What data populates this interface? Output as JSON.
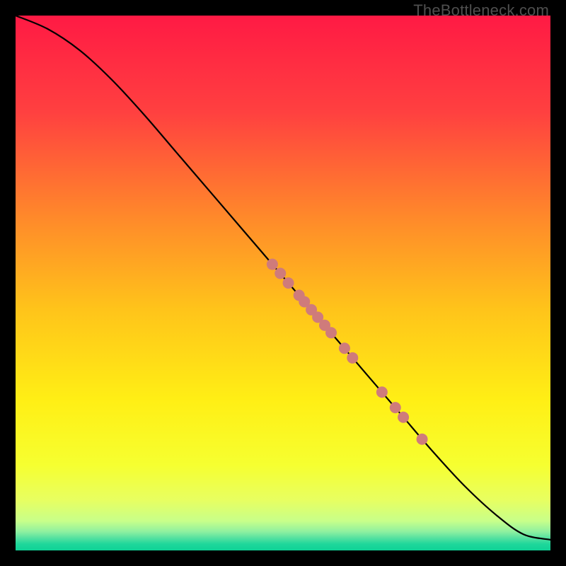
{
  "watermark": "TheBottleneck.com",
  "chart_data": {
    "type": "line",
    "title": "",
    "xlabel": "",
    "ylabel": "",
    "xlim": [
      0,
      100
    ],
    "ylim": [
      0,
      100
    ],
    "curve": {
      "name": "main-curve",
      "points": [
        {
          "x": 0,
          "y": 100
        },
        {
          "x": 6,
          "y": 97.5
        },
        {
          "x": 12,
          "y": 93.5
        },
        {
          "x": 18,
          "y": 88.0
        },
        {
          "x": 24,
          "y": 81.5
        },
        {
          "x": 30,
          "y": 74.5
        },
        {
          "x": 36,
          "y": 67.5
        },
        {
          "x": 42,
          "y": 60.5
        },
        {
          "x": 48,
          "y": 53.5
        },
        {
          "x": 54,
          "y": 46.5
        },
        {
          "x": 60,
          "y": 39.5
        },
        {
          "x": 66,
          "y": 32.5
        },
        {
          "x": 72,
          "y": 25.5
        },
        {
          "x": 78,
          "y": 18.5
        },
        {
          "x": 84,
          "y": 12.0
        },
        {
          "x": 90,
          "y": 6.5
        },
        {
          "x": 95,
          "y": 3.0
        },
        {
          "x": 100,
          "y": 2.0
        }
      ]
    },
    "markers": {
      "name": "highlighted-points",
      "color": "#cf7b7b",
      "radius_px": 8,
      "points": [
        {
          "x": 48.0,
          "y": 53.5
        },
        {
          "x": 49.5,
          "y": 51.8
        },
        {
          "x": 51.0,
          "y": 50.0
        },
        {
          "x": 53.0,
          "y": 47.7
        },
        {
          "x": 54.0,
          "y": 46.5
        },
        {
          "x": 55.3,
          "y": 45.0
        },
        {
          "x": 56.5,
          "y": 43.6
        },
        {
          "x": 57.8,
          "y": 42.1
        },
        {
          "x": 59.0,
          "y": 40.7
        },
        {
          "x": 61.5,
          "y": 37.8
        },
        {
          "x": 63.0,
          "y": 36.0
        },
        {
          "x": 68.5,
          "y": 29.6
        },
        {
          "x": 71.0,
          "y": 26.7
        },
        {
          "x": 72.5,
          "y": 24.9
        },
        {
          "x": 76.0,
          "y": 20.8
        }
      ]
    },
    "gradient_stops": [
      {
        "offset": 0.0,
        "color": "#ff1a44"
      },
      {
        "offset": 0.18,
        "color": "#ff4040"
      },
      {
        "offset": 0.38,
        "color": "#ff8a2a"
      },
      {
        "offset": 0.55,
        "color": "#ffc41a"
      },
      {
        "offset": 0.72,
        "color": "#ffef15"
      },
      {
        "offset": 0.84,
        "color": "#f6ff30"
      },
      {
        "offset": 0.905,
        "color": "#e8ff60"
      },
      {
        "offset": 0.945,
        "color": "#c8ff8a"
      },
      {
        "offset": 0.965,
        "color": "#8ef0a0"
      },
      {
        "offset": 0.978,
        "color": "#4fe0a0"
      },
      {
        "offset": 0.988,
        "color": "#1fd79b"
      },
      {
        "offset": 1.0,
        "color": "#0fd296"
      }
    ]
  }
}
